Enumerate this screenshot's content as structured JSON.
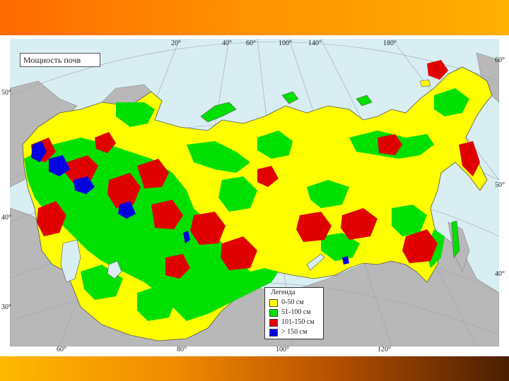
{
  "title": "Мощность почв",
  "top_lon_labels": [
    "20°",
    "40°",
    "60°",
    "100°",
    "140°",
    "180°"
  ],
  "bottom_lon_labels": [
    "60°",
    "80°",
    "100°",
    "120°"
  ],
  "left_lat_labels": [
    "50°",
    "40°",
    "30°"
  ],
  "right_lat_labels": [
    "60°",
    "50°",
    "40°"
  ],
  "legend": {
    "title": "Легенда",
    "items": [
      {
        "label": "0-50 см",
        "color": "#ffff00"
      },
      {
        "label": "51-100 см",
        "color": "#00e000"
      },
      {
        "label": "101-150 см",
        "color": "#e00000"
      },
      {
        "label": "> 150 см",
        "color": "#0000e0"
      }
    ]
  },
  "colors": {
    "sea": "#d8eef2",
    "land_outside": "#b8b8b8",
    "graticule": "#9aa4b2",
    "banner_top": "#ff8c00",
    "banner_bottom": "#b85000"
  }
}
